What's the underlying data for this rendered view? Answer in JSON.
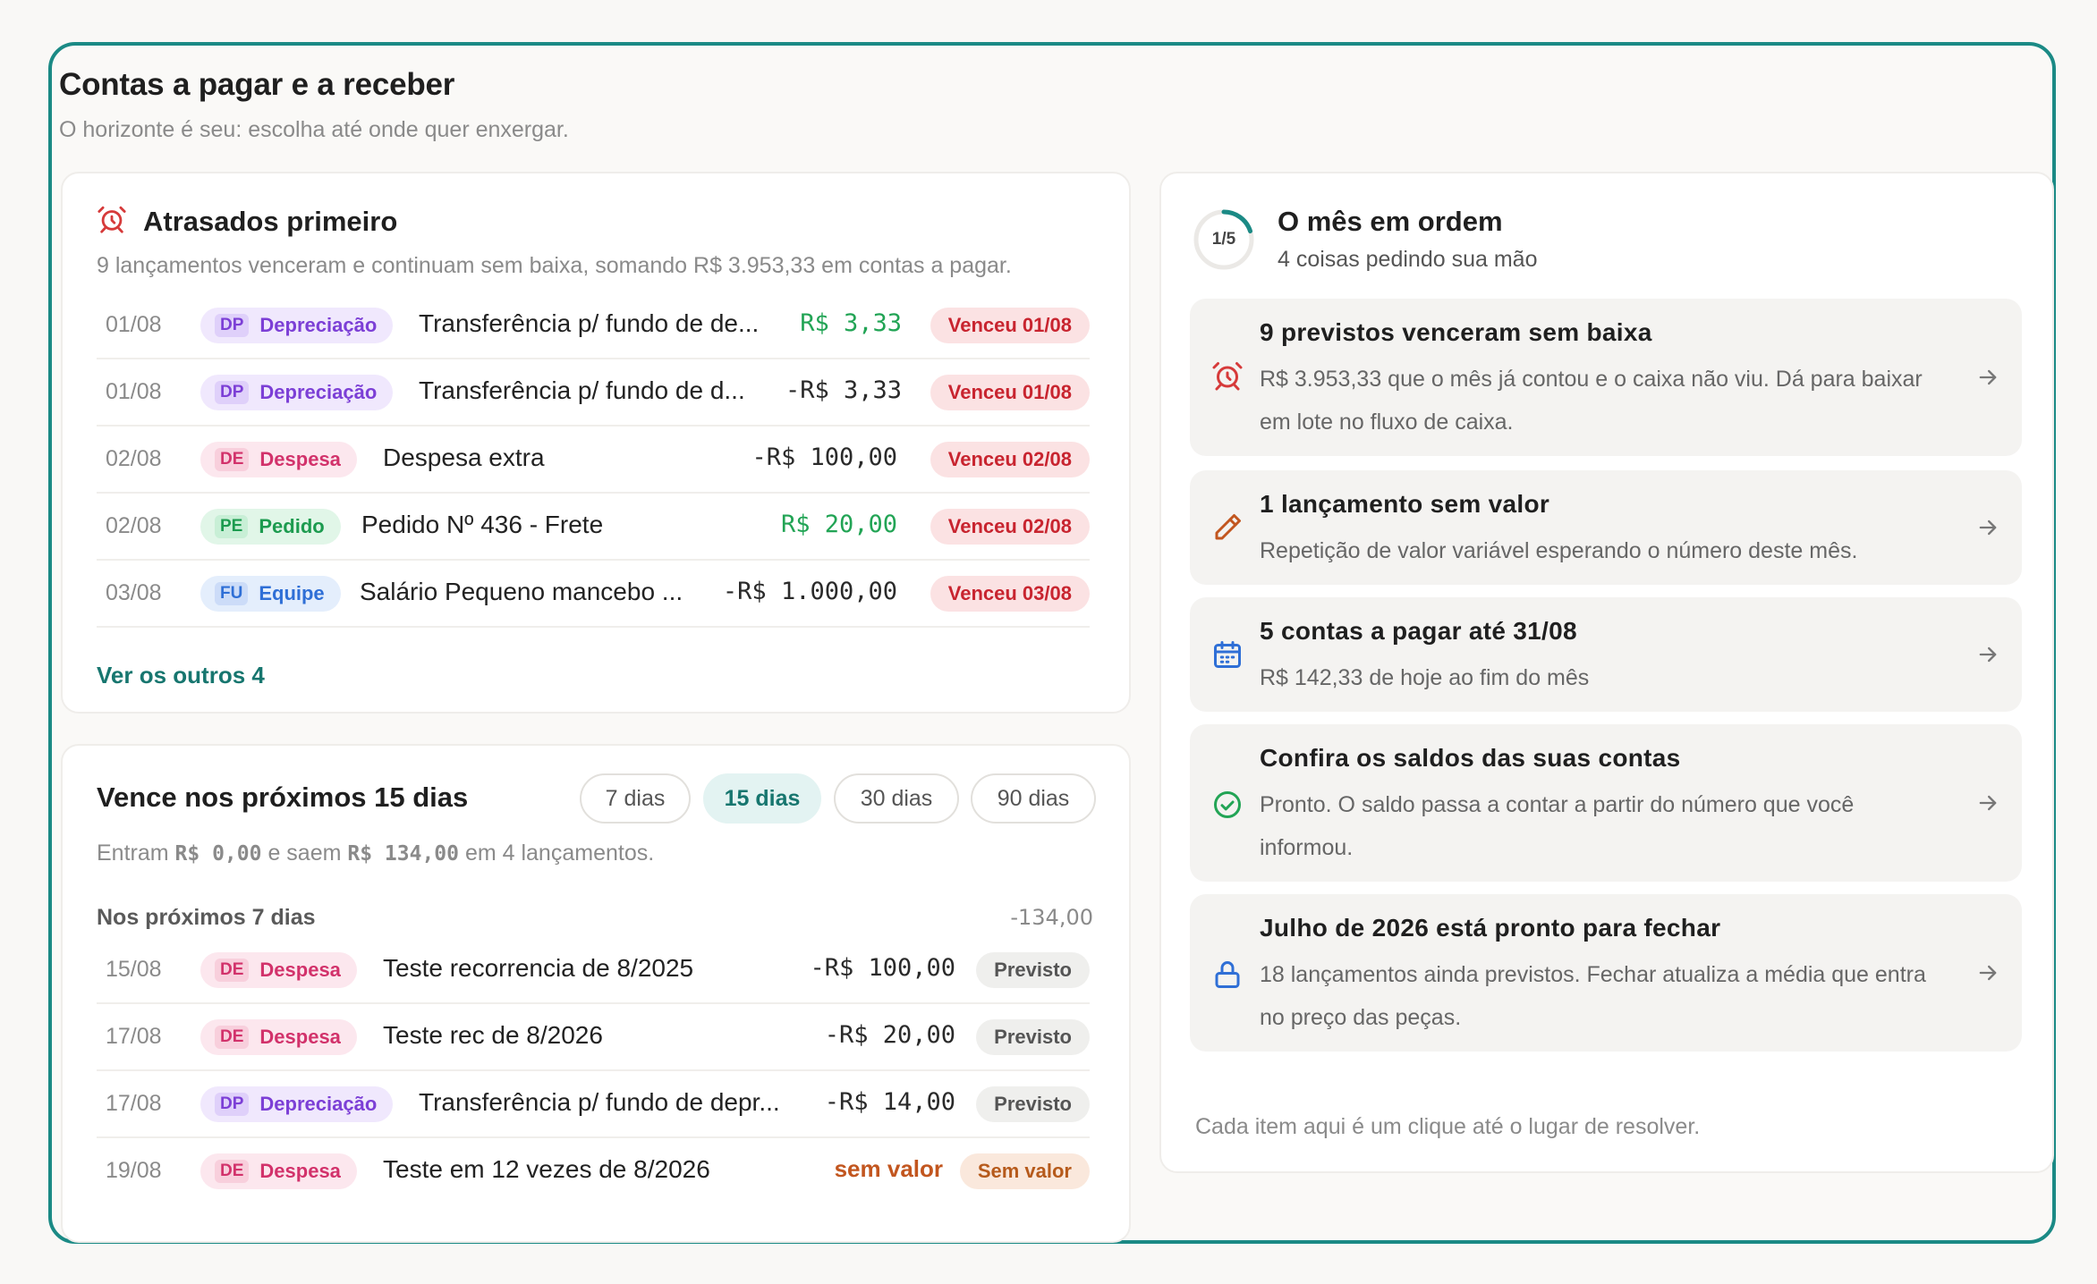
{
  "page": {
    "title": "Contas a pagar e a receber",
    "subtitle": "O horizonte é seu: escolha até onde quer enxergar."
  },
  "overdue": {
    "title": "Atrasados primeiro",
    "description": "9 lançamentos venceram e continuam sem baixa, somando R$ 3.953,33 em contas a pagar.",
    "rows": [
      {
        "date": "01/08",
        "abbr": "DP",
        "category": "Depreciação",
        "description": "Transferência p/ fundo de de...",
        "amount": "R$ 3,33",
        "status": "Venceu 01/08"
      },
      {
        "date": "01/08",
        "abbr": "DP",
        "category": "Depreciação",
        "description": "Transferência p/ fundo de d...",
        "amount": "-R$ 3,33",
        "status": "Venceu 01/08"
      },
      {
        "date": "02/08",
        "abbr": "DE",
        "category": "Despesa",
        "description": "Despesa extra",
        "amount": "-R$ 100,00",
        "status": "Venceu 02/08"
      },
      {
        "date": "02/08",
        "abbr": "PE",
        "category": "Pedido",
        "description": "Pedido Nº 436 - Frete",
        "amount": "R$ 20,00",
        "status": "Venceu 02/08"
      },
      {
        "date": "03/08",
        "abbr": "FU",
        "category": "Equipe",
        "description": "Salário Pequeno mancebo ...",
        "amount": "-R$ 1.000,00",
        "status": "Venceu 03/08"
      }
    ],
    "more_link": "Ver os outros 4"
  },
  "upcoming": {
    "title": "Vence nos próximos 15 dias",
    "ranges": [
      "7 dias",
      "15 dias",
      "30 dias",
      "90 dias"
    ],
    "active_range": "15 dias",
    "summary": {
      "prefix": "Entram",
      "in_amount": "R$ 0,00",
      "middle": "e saem",
      "out_amount": "R$ 134,00",
      "suffix": "em 4 lançamentos."
    },
    "group": {
      "label": "Nos próximos 7 dias",
      "total": "-134,00"
    },
    "rows": [
      {
        "date": "15/08",
        "abbr": "DE",
        "category": "Despesa",
        "description": "Teste recorrencia de 8/2025",
        "amount": "-R$ 100,00",
        "status": "Previsto"
      },
      {
        "date": "17/08",
        "abbr": "DE",
        "category": "Despesa",
        "description": "Teste rec de 8/2026",
        "amount": "-R$ 20,00",
        "status": "Previsto"
      },
      {
        "date": "17/08",
        "abbr": "DP",
        "category": "Depreciação",
        "description": "Transferência p/ fundo de depr...",
        "amount": "-R$ 14,00",
        "status": "Previsto"
      },
      {
        "date": "19/08",
        "abbr": "DE",
        "category": "Despesa",
        "description": "Teste em 12 vezes de 8/2026",
        "amount": "sem valor",
        "status": "Sem valor"
      }
    ]
  },
  "month": {
    "progress_label": "1/5",
    "progress_fraction": 0.2,
    "title": "O mês em ordem",
    "subtitle": "4 coisas pedindo sua mão",
    "tasks": [
      {
        "icon": "alarm-icon",
        "title": "9 previstos venceram sem baixa",
        "description": "R$ 3.953,33 que o mês já contou e o caixa não viu. Dá para baixar em lote no fluxo de caixa."
      },
      {
        "icon": "pencil-icon",
        "title": "1 lançamento sem valor",
        "description": "Repetição de valor variável esperando o número deste mês."
      },
      {
        "icon": "calendar-icon",
        "title": "5 contas a pagar até 31/08",
        "description": "R$ 142,33 de hoje ao fim do mês"
      },
      {
        "icon": "check-circle-icon",
        "title": "Confira os saldos das suas contas",
        "description": "Pronto. O saldo passa a contar a partir do número que você informou."
      },
      {
        "icon": "lock-icon",
        "title": "Julho de 2026 está pronto para fechar",
        "description": "18 lançamentos ainda previstos. Fechar atualiza a média que entra no preço das peças."
      }
    ],
    "footer": "Cada item aqui é um clique até o lugar de resolver."
  },
  "colors": {
    "accent": "#1b8a85",
    "overdue_red": "#c8242f",
    "positive_green": "#22a455",
    "warning_orange": "#c2561f"
  }
}
